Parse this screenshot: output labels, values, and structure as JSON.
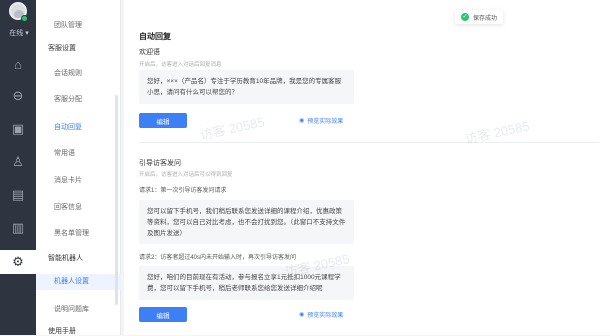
{
  "sidebar": {
    "status": "在线 ▾",
    "nav_icons": [
      "home-icon",
      "compass-icon",
      "dashboard-icon",
      "user-icon",
      "document-icon",
      "chart-icon",
      "gear-icon"
    ]
  },
  "submenu": {
    "items": [
      {
        "label": "团队管理",
        "type": "sub"
      },
      {
        "label": "客服设置",
        "type": "group"
      },
      {
        "label": "会话规则",
        "type": "sub"
      },
      {
        "label": "客服分配",
        "type": "sub"
      },
      {
        "label": "自动回复",
        "type": "sub-active"
      },
      {
        "label": "常用语",
        "type": "sub"
      },
      {
        "label": "消息卡片",
        "type": "sub"
      },
      {
        "label": "回客信息",
        "type": "sub"
      },
      {
        "label": "黑名单管理",
        "type": "sub"
      },
      {
        "label": "智能机器人",
        "type": "group"
      },
      {
        "label": "机器人设置",
        "type": "sub-selected"
      },
      {
        "label": "说明问题库",
        "type": "sub"
      },
      {
        "label": "使用手册",
        "type": "group"
      }
    ]
  },
  "toast": {
    "text": "保存成功"
  },
  "main": {
    "title": "自动回复",
    "welcome": {
      "label": "欢迎语",
      "hint": "开启后，访客进入对话后回复消息",
      "message": "您好，×××（产品名）专注于学历教育10年品牌，我是您的专属客服小思，请问有什么可以帮您的？",
      "edit_label": "编辑",
      "preview_label": "预览实际效果"
    },
    "guide": {
      "label": "引导访客发问",
      "hint": "开启后，访客进入对话后可以得到回复",
      "rule1_label": "请求1：第一次引导访客发问请求",
      "rule1_message": "您可以留下手机号，我们稍后联系您发送详细的课程介绍，优惠政策等资料，您可以自己对比考虑，也不会打扰到您。（此窗口不支持文件及图片发送）",
      "rule2_label": "请求2：访客者超过40s内未开始输入时，再次引导访客发问",
      "rule2_message": "您好，咱们的目前现在有活动，参与报名立享1元抵扣1000元课程学费，您可以留下手机号，稍后老师联系您给您发送详细介绍呢",
      "edit_label": "编辑",
      "preview_label": "预览实际效果"
    }
  },
  "watermark": "访客 20585"
}
